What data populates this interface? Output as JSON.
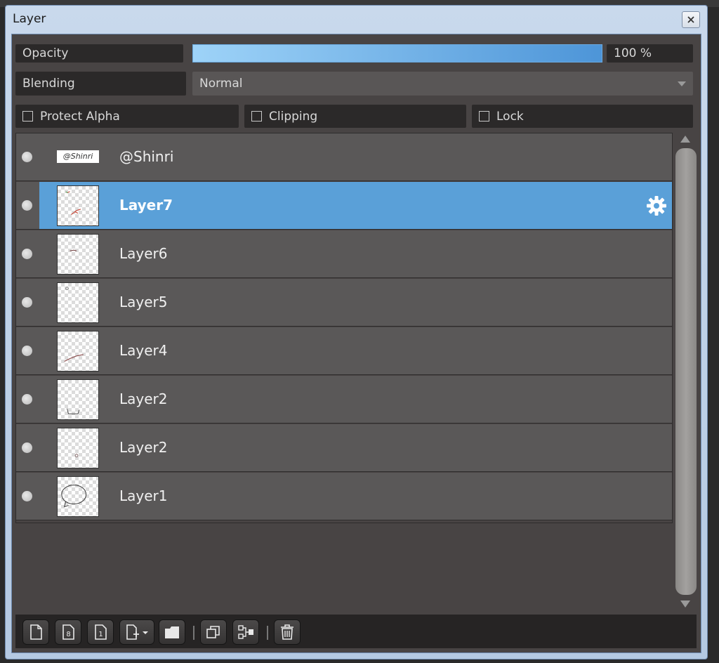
{
  "window": {
    "title": "Layer"
  },
  "controls": {
    "opacity_label": "Opacity",
    "opacity_value": "100 %",
    "opacity_fraction": 1.0,
    "blending_label": "Blending",
    "blending_value": "Normal",
    "protect_alpha_label": "Protect Alpha",
    "clipping_label": "Clipping",
    "lock_label": "Lock"
  },
  "layers": [
    {
      "name": "@Shinri",
      "thumb": "text",
      "thumb_text": "@Shinri",
      "selected": false
    },
    {
      "name": "Layer7",
      "thumb": "image",
      "selected": true
    },
    {
      "name": "Layer6",
      "thumb": "image",
      "selected": false
    },
    {
      "name": "Layer5",
      "thumb": "image",
      "selected": false
    },
    {
      "name": "Layer4",
      "thumb": "image",
      "selected": false
    },
    {
      "name": "Layer2",
      "thumb": "image",
      "selected": false
    },
    {
      "name": "Layer2",
      "thumb": "image",
      "selected": false
    },
    {
      "name": "Layer1",
      "thumb": "image",
      "selected": false
    }
  ],
  "toolbar": [
    {
      "icon": "new-layer-icon"
    },
    {
      "icon": "new-8bit-layer-icon"
    },
    {
      "icon": "new-1bit-layer-icon"
    },
    {
      "icon": "add-layer-dropdown-icon"
    },
    {
      "icon": "new-folder-icon"
    },
    {
      "icon": "duplicate-layer-icon"
    },
    {
      "icon": "merge-down-icon"
    },
    {
      "icon": "delete-layer-icon"
    }
  ],
  "colors": {
    "selection": "#5aa0d8",
    "panel": "#484444",
    "row": "#5a5858"
  }
}
